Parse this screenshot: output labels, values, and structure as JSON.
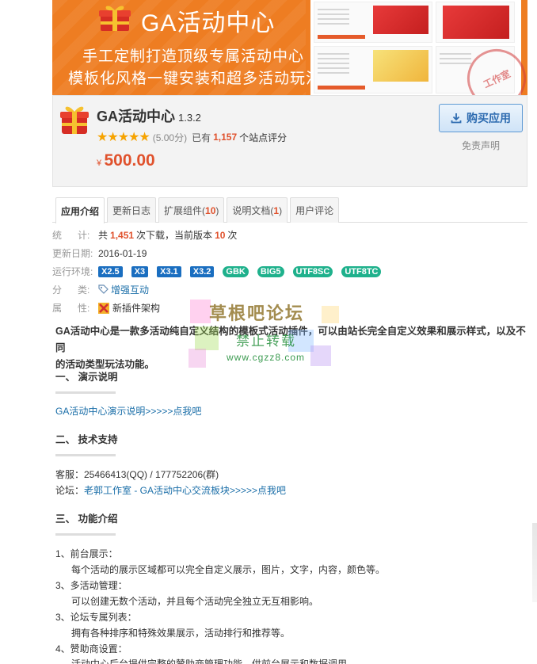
{
  "banner": {
    "title": "GA活动中心",
    "line1": "手工定制打造顶级专属活动中心",
    "line2": "模板化风格一键安装和超多活动玩法",
    "stamp": "工作室",
    "brand_color": "#ee7d22"
  },
  "product": {
    "name": "GA活动中心",
    "version": "1.3.2",
    "stars": "★★★★★",
    "score": "(5.00分)",
    "rating_prefix": "已有",
    "rating_count": "1,157",
    "rating_suffix": "个站点评分",
    "currency": "¥",
    "price": "500.00",
    "buy_label": "购买应用",
    "disclaimer": "免责声明"
  },
  "tabs": [
    {
      "label": "应用介绍",
      "count": ""
    },
    {
      "label": "更新日志",
      "count": ""
    },
    {
      "label": "扩展组件(",
      "count": "10",
      "close": ")"
    },
    {
      "label": "说明文档(",
      "count": "1",
      "close": ")"
    },
    {
      "label": "用户评论",
      "count": ""
    }
  ],
  "meta": {
    "stats_label": "统      计:",
    "stats_pre": "共",
    "downloads": "1,451",
    "stats_mid": "次下载，当前版本",
    "version_downloads": "10",
    "stats_post": "次",
    "updated_label": "更新日期:",
    "updated": "2016-01-19",
    "env_label": "运行环境:",
    "env_badges": [
      "X2.5",
      "X3",
      "X3.1",
      "X3.2"
    ],
    "charset_badges": [
      "GBK",
      "BIG5",
      "UTF8SC",
      "UTF8TC"
    ],
    "category_label": "分      类:",
    "category": "增强互动",
    "attr_label": "属      性:",
    "attr": "新插件架构"
  },
  "content": {
    "desc_line1": "GA活动中心是一款多活动纯自定义结构的模板式活动插件，可以由站长完全自定义效果和展示样式，以及不同",
    "desc_line2": "的活动类型玩法功能。",
    "s1_title": "一、 演示说明",
    "s1_link": "GA活动中心演示说明>>>>>点我吧",
    "s2_title": "二、 技术支持",
    "s2_service": "客服：25466413(QQ) / 177752206(群)",
    "s2_forum_label": "论坛：",
    "s2_forum_link": "老郭工作室 - GA活动中心交流板块>>>>>点我吧",
    "s3_title": "三、 功能介绍",
    "f1_title": "1、前台展示：",
    "f1_desc": "每个活动的展示区域都可以完全自定义展示，图片，文字，内容，颜色等。",
    "f2_title": "3、多活动管理：",
    "f2_desc": "可以创建无数个活动，并且每个活动完全独立无互相影响。",
    "f3_title": "3、论坛专属列表：",
    "f3_desc": "拥有各种排序和特殊效果展示，活动排行和推荐等。",
    "f4_title": "4、赞助商设置：",
    "f4_desc": "活动中心后台提供完整的赞助商管理功能，供前台展示和数据调用。"
  },
  "watermark": {
    "title": "草根吧论坛",
    "sub": "禁止转载",
    "url": "www.cgzz8.com"
  }
}
